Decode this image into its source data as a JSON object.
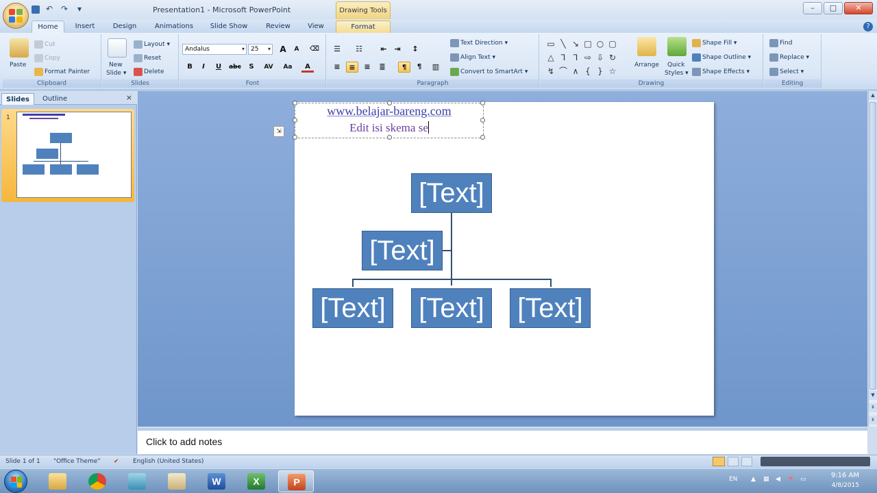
{
  "window": {
    "title": "Presentation1 - Microsoft PowerPoint",
    "context_tab": "Drawing Tools",
    "controls": {
      "minimize": "–",
      "maximize": "□",
      "close": "✕"
    }
  },
  "qat": {
    "save_icon": "save-icon",
    "undo": "↶",
    "redo": "↷",
    "customize": "▾"
  },
  "tabs": [
    "Home",
    "Insert",
    "Design",
    "Animations",
    "Slide Show",
    "Review",
    "View",
    "Format"
  ],
  "ribbon": {
    "clipboard": {
      "label": "Clipboard",
      "paste": "Paste",
      "cut": "Cut",
      "copy": "Copy",
      "format_painter": "Format Painter"
    },
    "slides": {
      "label": "Slides",
      "new_slide": "New",
      "new_slide2": "Slide ▾",
      "layout": "Layout ▾",
      "reset": "Reset",
      "delete": "Delete"
    },
    "font": {
      "label": "Font",
      "font_name": "Andalus",
      "font_size": "25",
      "grow": "A",
      "shrink": "A",
      "bold": "B",
      "italic": "I",
      "underline": "U",
      "strike": "abc",
      "shadow": "S",
      "spacing": "AV",
      "case": "Aa",
      "color": "A"
    },
    "paragraph": {
      "label": "Paragraph",
      "text_direction": "Text Direction ▾",
      "align_text": "Align Text ▾",
      "convert_smartart": "Convert to SmartArt ▾"
    },
    "drawing": {
      "label": "Drawing",
      "arrange": "Arrange",
      "quick_styles": "Quick",
      "quick_styles2": "Styles ▾",
      "shape_fill": "Shape Fill ▾",
      "shape_outline": "Shape Outline ▾",
      "shape_effects": "Shape Effects ▾"
    },
    "editing": {
      "label": "Editing",
      "find": "Find",
      "replace": "Replace ▾",
      "select": "Select ▾"
    }
  },
  "left_panel": {
    "tab_slides": "Slides",
    "tab_outline": "Outline",
    "close": "×",
    "slide_number": "1"
  },
  "slide": {
    "title_line1": "www.belajar-bareng.com",
    "title_line2": "Edit isi skema se",
    "smartart_boxes": [
      "[Text]",
      "[Text]",
      "[Text]",
      "[Text]",
      "[Text]"
    ]
  },
  "notes": {
    "placeholder": "Click to add notes"
  },
  "status": {
    "slide_of": "Slide 1 of 1",
    "theme": "\"Office Theme\"",
    "language": "English (United States)"
  },
  "taskbar": {
    "lang": "EN",
    "time": "9:16 AM",
    "date": "4/8/2015"
  }
}
